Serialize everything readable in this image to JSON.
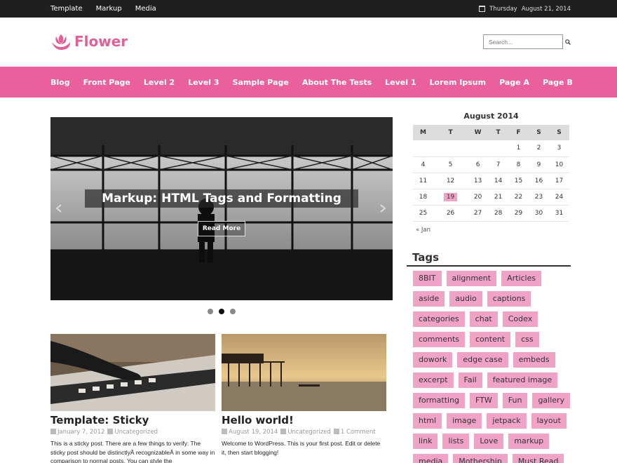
{
  "topbar": {
    "menu": [
      "Template",
      "Markup",
      "Media"
    ],
    "day": "Thursday",
    "date": "August 21, 2014"
  },
  "site": {
    "title": "Flower"
  },
  "search": {
    "placeholder": "Search..."
  },
  "nav": [
    "Blog",
    "Front Page",
    "Level 2",
    "Level 3",
    "Sample Page",
    "About The Tests",
    "Level 1",
    "Lorem Ipsum",
    "Page A",
    "Page B"
  ],
  "slider": {
    "caption": "Markup: HTML Tags and Formatting",
    "read_more": "Read More",
    "slides": 3,
    "active_slide": 2
  },
  "posts": [
    {
      "title": "Template: Sticky",
      "date": "January 7, 2012",
      "category": "Uncategorized",
      "comments": "",
      "excerpt": "This is a sticky post. There are a few things to verify: The sticky post should be distinctlyÂ recognizableÂ in some way in comparison to normal posts. You can style the"
    },
    {
      "title": "Hello world!",
      "date": "August 19, 2014",
      "category": "Uncategorized",
      "comments": "1 Comment",
      "excerpt": "Welcome to WordPress. This is your first post. Edit or delete it, then start blogging!"
    }
  ],
  "calendar": {
    "caption": "August 2014",
    "days": [
      "M",
      "T",
      "W",
      "T",
      "F",
      "S",
      "S"
    ],
    "weeks": [
      [
        "",
        "",
        "",
        "",
        "1",
        "2",
        "3"
      ],
      [
        "4",
        "5",
        "6",
        "7",
        "8",
        "9",
        "10"
      ],
      [
        "11",
        "12",
        "13",
        "14",
        "15",
        "16",
        "17"
      ],
      [
        "18",
        "19",
        "20",
        "21",
        "22",
        "23",
        "24"
      ],
      [
        "25",
        "26",
        "27",
        "28",
        "29",
        "30",
        "31"
      ]
    ],
    "today": "19",
    "prev": "« Jan"
  },
  "tags": {
    "title": "Tags",
    "items": [
      "8BIT",
      "alignment",
      "Articles",
      "aside",
      "audio",
      "captions",
      "categories",
      "chat",
      "Codex",
      "comments",
      "content",
      "css",
      "dowork",
      "edge case",
      "embeds",
      "excerpt",
      "Fail",
      "featured image",
      "formatting",
      "FTW",
      "Fun",
      "gallery",
      "html",
      "image",
      "jetpack",
      "layout",
      "link",
      "lists",
      "Love",
      "markup",
      "media",
      "Mothership",
      "Must Read"
    ]
  },
  "colors": {
    "accent": "#e9609c",
    "tag_bg": "#f0a3c6",
    "topbar": "#1f1f1f"
  }
}
